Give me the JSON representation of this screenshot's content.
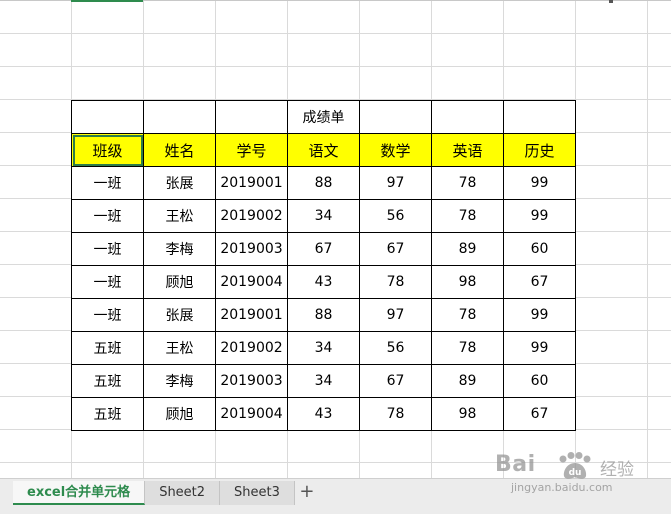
{
  "table": {
    "title": "成绩单",
    "headers": [
      "班级",
      "姓名",
      "学号",
      "语文",
      "数学",
      "英语",
      "历史"
    ],
    "rows": [
      [
        "一班",
        "张展",
        "2019001",
        "88",
        "97",
        "78",
        "99"
      ],
      [
        "一班",
        "王松",
        "2019002",
        "34",
        "56",
        "78",
        "99"
      ],
      [
        "一班",
        "李梅",
        "2019003",
        "67",
        "67",
        "89",
        "60"
      ],
      [
        "一班",
        "顾旭",
        "2019004",
        "43",
        "78",
        "98",
        "67"
      ],
      [
        "一班",
        "张展",
        "2019001",
        "88",
        "97",
        "78",
        "99"
      ],
      [
        "五班",
        "王松",
        "2019002",
        "34",
        "56",
        "78",
        "99"
      ],
      [
        "五班",
        "李梅",
        "2019003",
        "34",
        "67",
        "89",
        "60"
      ],
      [
        "五班",
        "顾旭",
        "2019004",
        "43",
        "78",
        "98",
        "67"
      ]
    ]
  },
  "tabs": [
    {
      "label": "excel合并单元格",
      "active": true
    },
    {
      "label": "Sheet2",
      "active": false
    },
    {
      "label": "Sheet3",
      "active": false
    }
  ],
  "add_tab_label": "+",
  "watermark": {
    "brand": "Bai",
    "extra": "经验",
    "url": "jingyan.baidu.com"
  },
  "colors": {
    "header_fill": "#ffff00",
    "accent": "#2e8b4e",
    "gridline": "#dadada"
  }
}
